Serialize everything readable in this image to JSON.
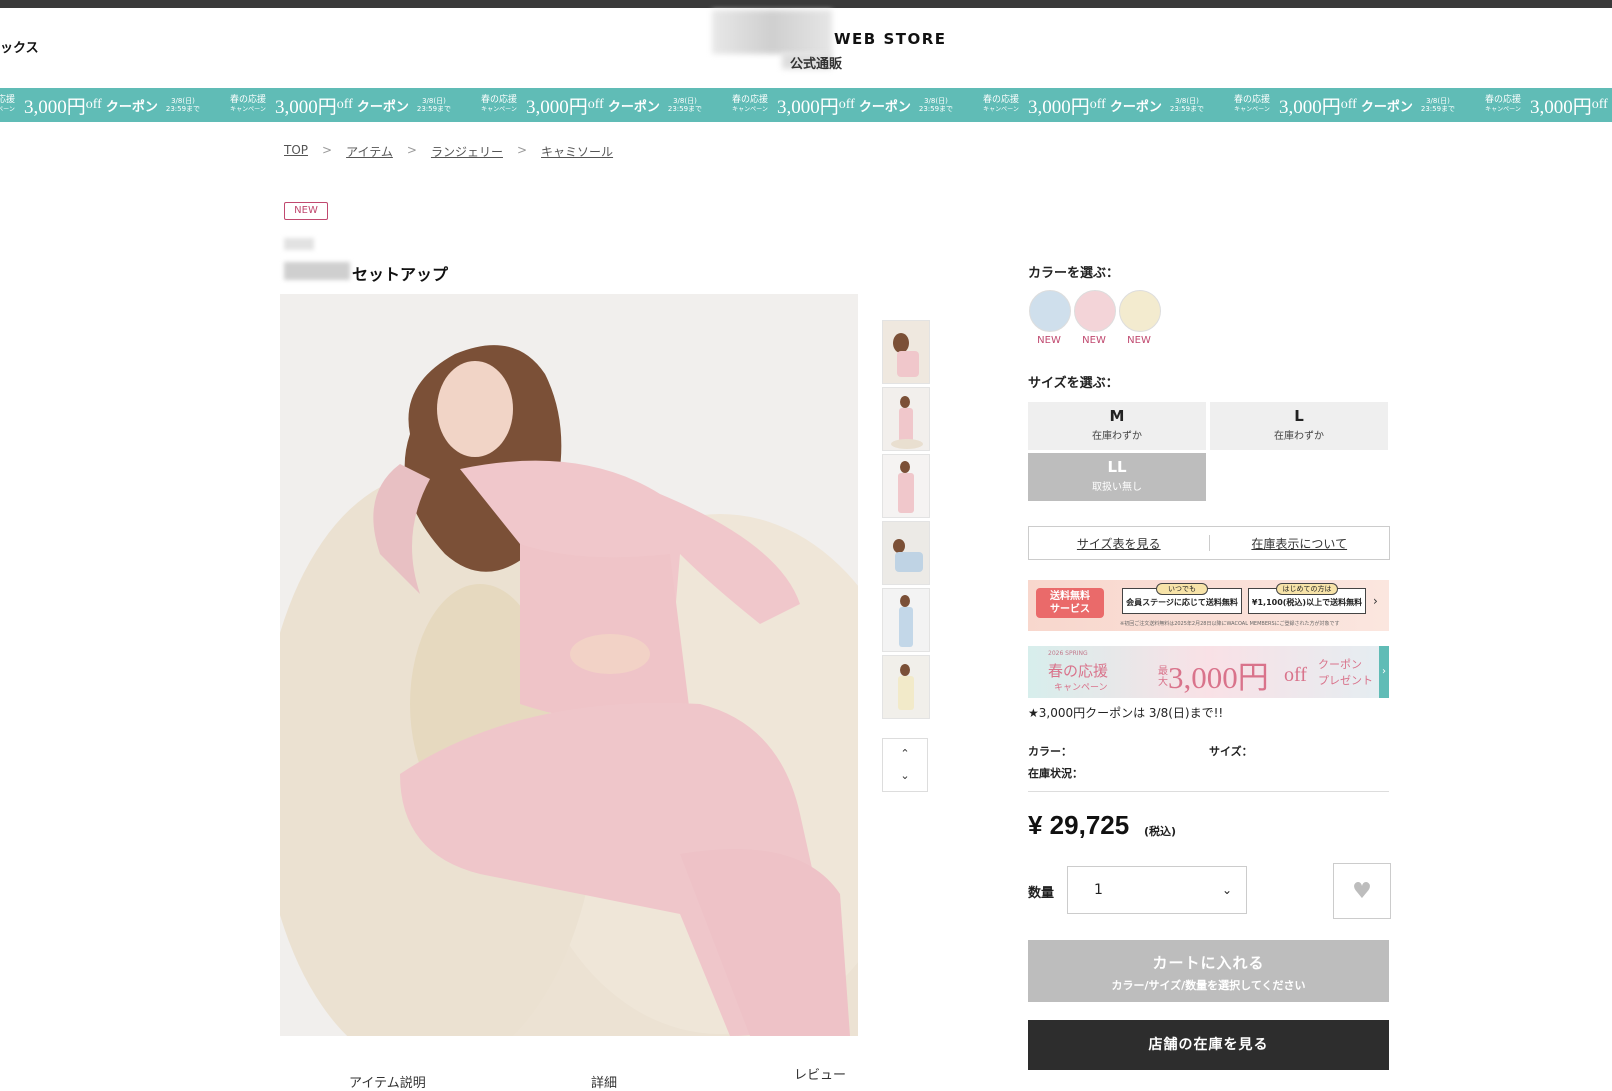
{
  "header": {
    "left_text": "ックス",
    "logo_title": "WEB STORE",
    "logo_sub": "公式通販"
  },
  "banner": {
    "item_small": "春の応援",
    "item_small2": "キャンペーン",
    "item_amount": "3,000円",
    "item_off": "off",
    "item_coupon": "クーポン",
    "item_date": "3/8(日)",
    "item_time": "23:59まで",
    "color": "#60bcb6"
  },
  "breadcrumb": [
    "TOP",
    "アイテム",
    "ランジェリー",
    "キャミソール"
  ],
  "breadcrumb_sep": ">",
  "product": {
    "badge": "NEW",
    "title": "セットアップ"
  },
  "colors": {
    "label": "カラーを選ぶ：",
    "items": [
      {
        "tag": "NEW",
        "color": "#cfdfec"
      },
      {
        "tag": "NEW",
        "color": "#f3d4d8"
      },
      {
        "tag": "NEW",
        "color": "#f3ebcf"
      }
    ]
  },
  "sizes": {
    "label": "サイズを選ぶ：",
    "items": [
      {
        "size": "M",
        "status": "在庫わずか"
      },
      {
        "size": "L",
        "status": "在庫わずか"
      },
      {
        "size": "LL",
        "status": "取扱い無し"
      }
    ]
  },
  "links": {
    "size_chart": "サイズ表を見る",
    "stock_info": "在庫表示について"
  },
  "promo1": {
    "free_ship": "送料無料",
    "service": "サービス",
    "always": "いつでも",
    "member_text": "会員ステージに応じて送料無料",
    "first_time": "はじめての方は",
    "first_text": "¥1,100(税込)以上で送料無料",
    "fine_print": "※初回ご注文送料無料は2025年2月28日以降にWACOAL MEMBERSにご登録された方が対象です"
  },
  "promo2": {
    "campaign": "春の応援",
    "campaign_sub": "キャンペーン",
    "max": "最大",
    "amount": "3,000円",
    "off": "off",
    "coupon": "クーポン",
    "present": "プレゼント",
    "spring": "2026 SPRING"
  },
  "coupon_note": "★3,000円クーポンは 3/8(日)まで!!",
  "info": {
    "color_label": "カラー：",
    "size_label": "サイズ：",
    "stock_label": "在庫状況："
  },
  "price": {
    "value": "¥ 29,725",
    "tax": "(税込)"
  },
  "quantity": {
    "label": "数量",
    "value": "1"
  },
  "cart": {
    "label": "カートに入れる",
    "sub": "カラー/サイズ/数量を選択してください"
  },
  "store_stock": "店舗の在庫を見る",
  "tabs": [
    "アイテム説明",
    "詳細",
    "レビュー"
  ]
}
